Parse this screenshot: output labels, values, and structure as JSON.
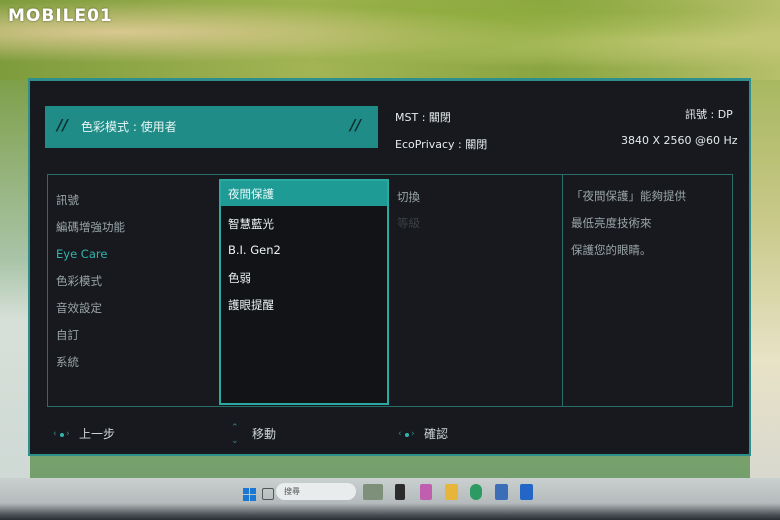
{
  "watermark": {
    "brand": "MOBILE01"
  },
  "osd": {
    "color_mode_bar": {
      "label": "色彩模式 : 使用者"
    },
    "mst": "MST : 關閉",
    "ecoprivacy": "EcoPrivacy : 關閉",
    "signal": "訊號 : DP",
    "resolution": "3840 X 2560 @60 Hz",
    "main_menu": [
      {
        "label": "訊號",
        "active": false
      },
      {
        "label": "編碼增強功能",
        "active": false
      },
      {
        "label": "Eye Care",
        "active": true
      },
      {
        "label": "色彩模式",
        "active": false
      },
      {
        "label": "音效設定",
        "active": false
      },
      {
        "label": "自訂",
        "active": false
      },
      {
        "label": "系統",
        "active": false
      }
    ],
    "submenu": {
      "selected": "夜間保護",
      "items": [
        "智慧藍光",
        "B.I. Gen2",
        "色弱",
        "護眼提醒"
      ]
    },
    "options": [
      {
        "label": "切換",
        "enabled": true
      },
      {
        "label": "等級",
        "enabled": false
      }
    ],
    "description": [
      "「夜間保護」能夠提供",
      "最低亮度技術來",
      "保護您的眼睛。"
    ],
    "navigation": {
      "back": "上一步",
      "move": "移動",
      "confirm": "確認"
    }
  },
  "taskbar": {
    "search_placeholder": "搜尋",
    "icons": [
      "windows-start-icon",
      "widgets-icon",
      "explorer-icon",
      "copilot-icon",
      "file-explorer-icon",
      "edge-icon",
      "store-icon",
      "outlook-icon"
    ]
  },
  "colors": {
    "accent": "#1f8c88",
    "panel_bg": "#17191e",
    "border": "#2e8f8c"
  }
}
